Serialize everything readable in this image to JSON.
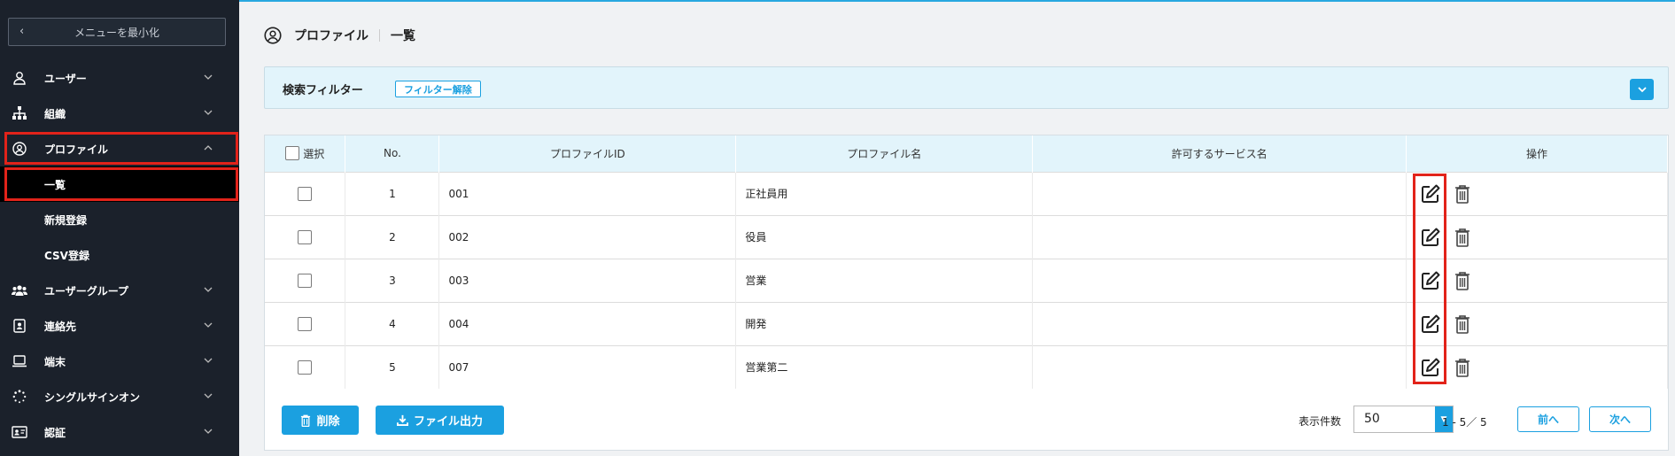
{
  "sidebar": {
    "minimize_label": "メニューを最小化",
    "items": [
      {
        "label": "ユーザー",
        "icon": "user-icon"
      },
      {
        "label": "組織",
        "icon": "org-icon"
      },
      {
        "label": "プロファイル",
        "icon": "profile-icon"
      },
      {
        "label": "ユーザーグループ",
        "icon": "users-icon"
      },
      {
        "label": "連絡先",
        "icon": "contact-icon"
      },
      {
        "label": "端末",
        "icon": "laptop-icon"
      },
      {
        "label": "シングルサインオン",
        "icon": "sso-icon"
      },
      {
        "label": "認証",
        "icon": "id-card-icon"
      }
    ],
    "sub_items": [
      "一覧",
      "新規登録",
      "CSV登録"
    ]
  },
  "breadcrumb": {
    "section": "プロファイル",
    "page": "一覧"
  },
  "filter": {
    "title": "検索フィルター",
    "clear_label": "フィルター解除"
  },
  "table": {
    "headers": {
      "select": "選択",
      "no": "No.",
      "profile_id": "プロファイルID",
      "profile_name": "プロファイル名",
      "services": "許可するサービス名",
      "ops": "操作"
    },
    "rows": [
      {
        "no": "1",
        "id": "001",
        "name": "正社員用",
        "services": ""
      },
      {
        "no": "2",
        "id": "002",
        "name": "役員",
        "services": ""
      },
      {
        "no": "3",
        "id": "003",
        "name": "営業",
        "services": ""
      },
      {
        "no": "4",
        "id": "004",
        "name": "開発",
        "services": ""
      },
      {
        "no": "5",
        "id": "007",
        "name": "営業第二",
        "services": ""
      }
    ]
  },
  "footer": {
    "delete_label": "削除",
    "export_label": "ファイル出力",
    "count_label": "表示件数",
    "count_value": "50",
    "range": "1 - 5／ 5",
    "prev_label": "前へ",
    "next_label": "次へ"
  },
  "colors": {
    "accent": "#1ba0e0",
    "sidebar_bg": "#1b212b",
    "highlight": "#e2231a",
    "filter_bg": "#e2f4fb"
  }
}
